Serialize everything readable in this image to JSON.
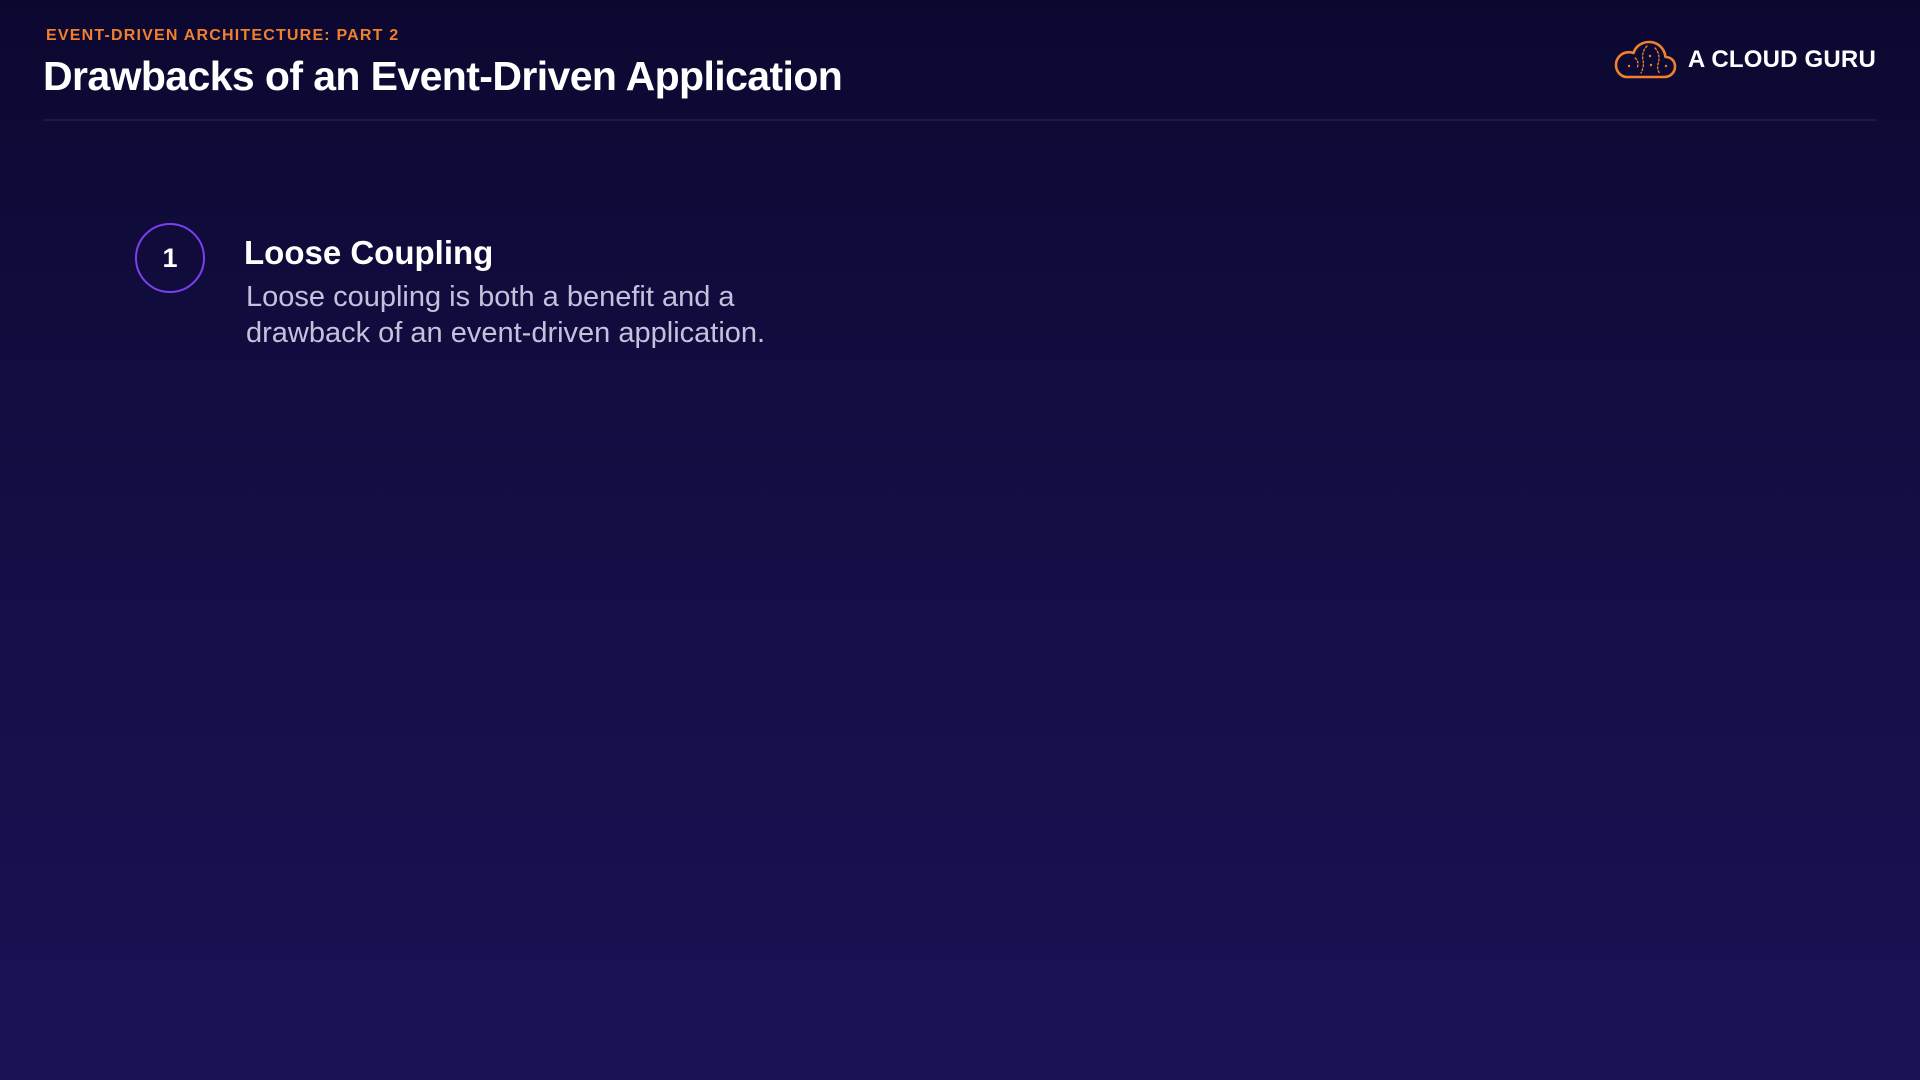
{
  "slide": {
    "eyebrow": "EVENT-DRIVEN ARCHITECTURE: PART 2",
    "title": "Drawbacks of an Event-Driven Application"
  },
  "brand": {
    "name": "A CLOUD GURU",
    "logo_icon": "cloud-brain-icon",
    "accent_color": "#f07f2e"
  },
  "items": [
    {
      "number": "1",
      "title": "Loose Coupling",
      "description": "Loose coupling is both a benefit and a drawback of an event-driven application."
    }
  ],
  "colors": {
    "background_top": "#0b0830",
    "background_bottom": "#1a1255",
    "number_ring": "#7b3ff2",
    "description_text": "#c6c0dc"
  }
}
